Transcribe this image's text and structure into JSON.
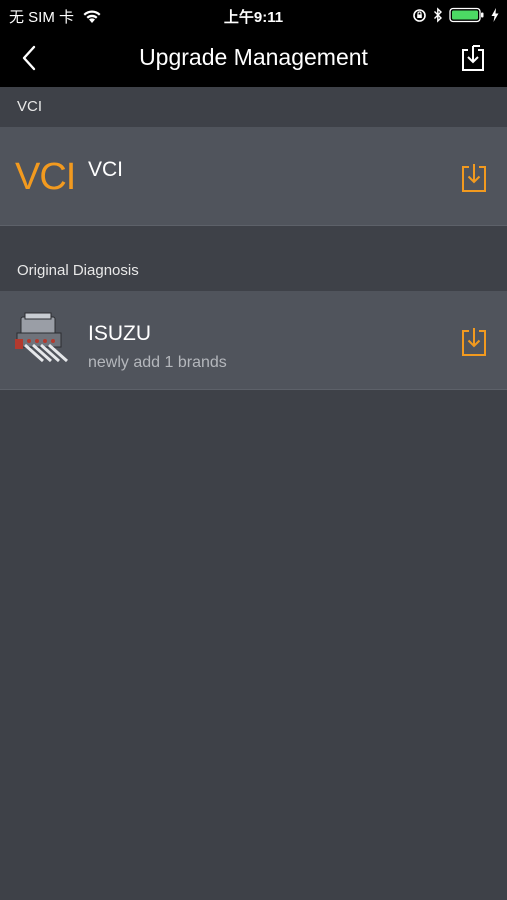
{
  "status_bar": {
    "carrier": "无 SIM 卡",
    "time": "上午9:11"
  },
  "nav": {
    "title": "Upgrade Management",
    "back_icon": "chevron-left-icon",
    "download_icon": "download-all-icon"
  },
  "sections": [
    {
      "header": "VCI",
      "items": [
        {
          "logo_text": "VCI",
          "title": "VCI",
          "subtitle": ""
        }
      ]
    },
    {
      "header": "Original Diagnosis",
      "items": [
        {
          "logo": "engine-icon",
          "title": "ISUZU",
          "subtitle": "newly add 1 brands"
        }
      ]
    }
  ],
  "colors": {
    "accent": "#f29a1f",
    "background": "#3e4148",
    "row": "#50545c",
    "bar": "#000000",
    "battery": "#4cd964"
  }
}
